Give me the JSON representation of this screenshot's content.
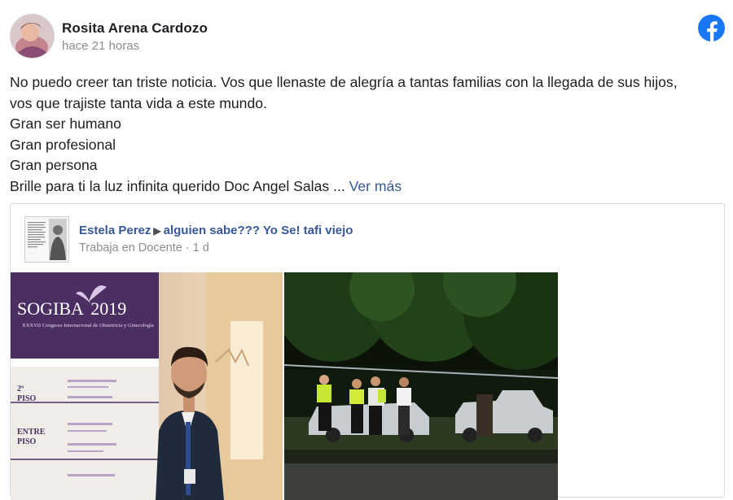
{
  "post": {
    "author": "Rosita Arena Cardozo",
    "time": "hace 21 horas",
    "lines": [
      "No puedo creer tan triste noticia. Vos que llenaste de alegría a tantas familias con la llegada de sus hijos,",
      "vos que trajiste tanta vida a este mundo.",
      "Gran ser humano",
      "Gran profesional",
      "Gran persona",
      "Brille para ti la luz infinita querido Doc Angel Salas ..."
    ],
    "see_more": "Ver más"
  },
  "shared": {
    "author": "Estela Perez",
    "group": "alguien sabe??? Yo Se! tafi viejo",
    "meta": "Trabaja en Docente · 1 d",
    "photo1": {
      "brand": "SOGIBA",
      "year": "2019",
      "subtitle": "XXXVII Congreso Internacional de Obstetricia y Ginecología",
      "floor1": "2º",
      "floor1b": "PISO",
      "floor2": "ENTRE",
      "floor2b": "PISO"
    }
  },
  "icons": {
    "brand": "facebook-icon"
  },
  "colors": {
    "link": "#385898",
    "fb_blue": "#1877f2",
    "meta": "#8a8d91",
    "banner_purple": "#4b2f63"
  }
}
